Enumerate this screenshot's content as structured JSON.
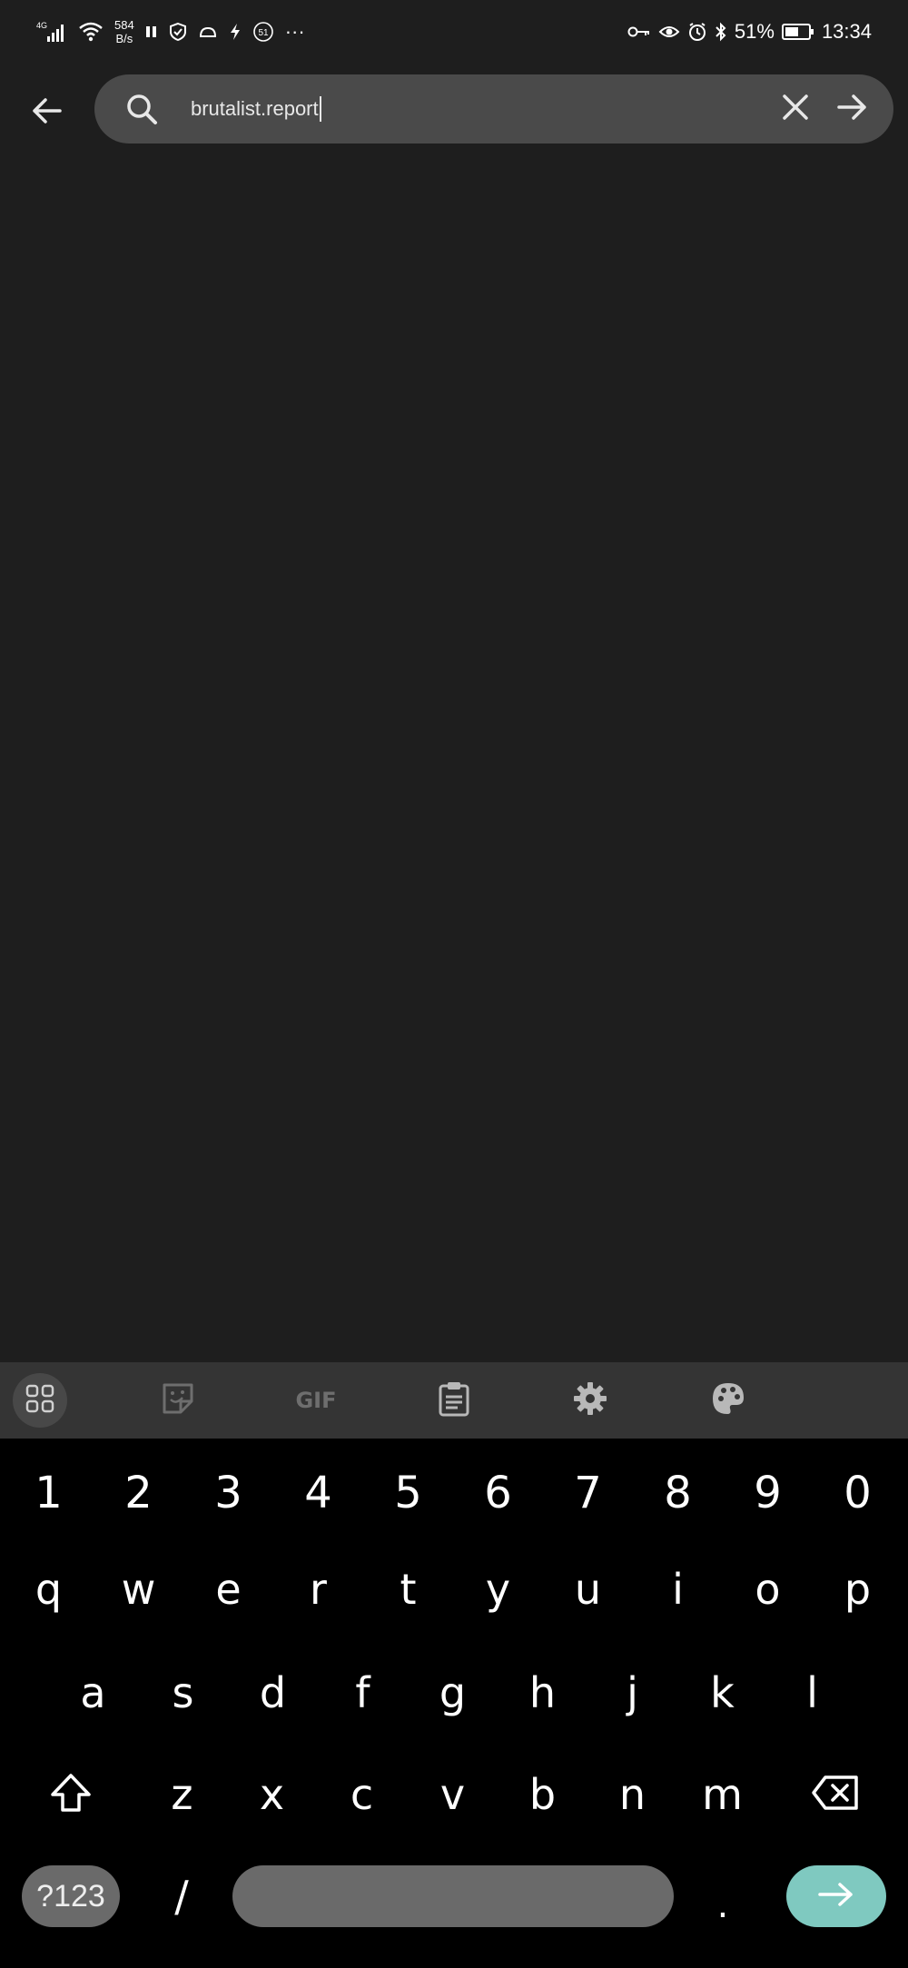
{
  "status_bar": {
    "network_type": "4G",
    "net_speed_value": "584",
    "net_speed_unit": "B/s",
    "notification_count": "51",
    "more_indicator": "···",
    "battery_percent": "51%",
    "time": "13:34",
    "icons_left": [
      "signal-icon",
      "wifi-icon",
      "pause-icon",
      "shield-icon",
      "cloud-icon",
      "bolt-icon",
      "notification-badge-icon",
      "more-icon"
    ],
    "icons_right": [
      "key-icon",
      "eye-icon",
      "alarm-icon",
      "bluetooth-icon",
      "battery-icon"
    ]
  },
  "search": {
    "query": "brutalist.report",
    "back_icon": "arrow-left-icon",
    "search_icon": "search-icon",
    "clear_icon": "close-icon",
    "go_icon": "arrow-right-icon"
  },
  "keyboard_toolbar": {
    "items": [
      "apps-grid-icon",
      "sticker-icon",
      "gif-icon",
      "clipboard-icon",
      "settings-gear-icon",
      "palette-icon"
    ],
    "gif_label": "GIF"
  },
  "keyboard": {
    "number_row": [
      "1",
      "2",
      "3",
      "4",
      "5",
      "6",
      "7",
      "8",
      "9",
      "0"
    ],
    "row1": [
      "q",
      "w",
      "e",
      "r",
      "t",
      "y",
      "u",
      "i",
      "o",
      "p"
    ],
    "row2": [
      "a",
      "s",
      "d",
      "f",
      "g",
      "h",
      "j",
      "k",
      "l"
    ],
    "row3": [
      "z",
      "x",
      "c",
      "v",
      "b",
      "n",
      "m"
    ],
    "symbols_label": "?123",
    "slash_label": "/",
    "period_label": ".",
    "shift_icon": "shift-icon",
    "backspace_icon": "backspace-icon",
    "enter_icon": "arrow-right-icon"
  },
  "colors": {
    "background": "#1e1e1e",
    "search_pill": "#4a4a4a",
    "toolbar": "#343434",
    "keyboard": "#000000",
    "key_pill": "#6a6a6a",
    "accent": "#7fc9c0"
  }
}
